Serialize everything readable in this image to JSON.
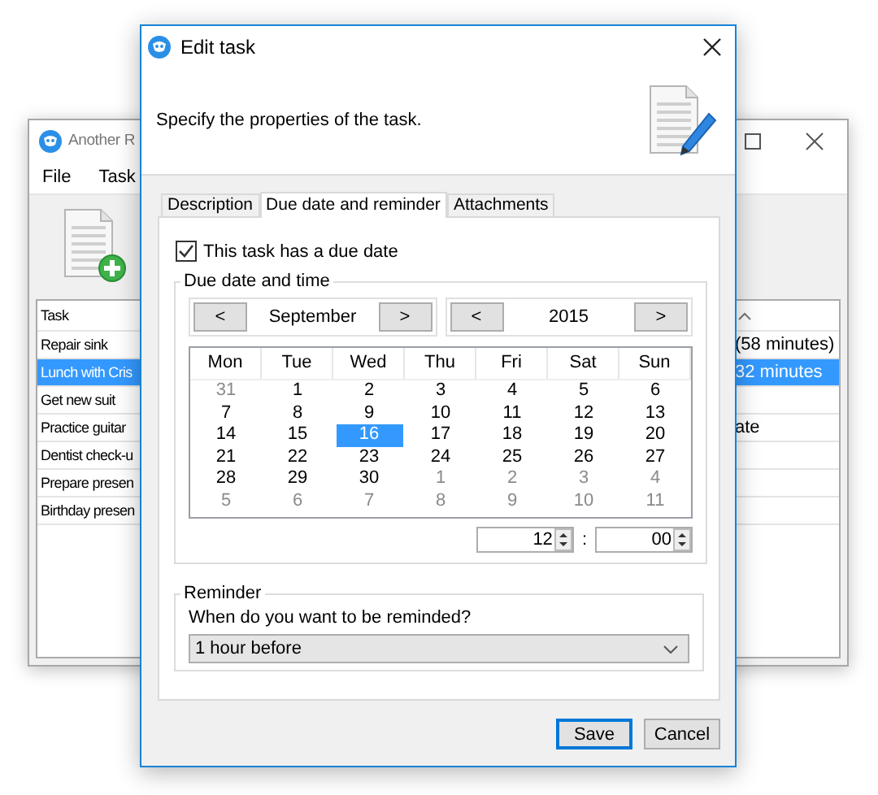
{
  "background_window": {
    "title": "Another R",
    "menu": [
      "File",
      "Task"
    ],
    "table": {
      "columns": [
        "Task"
      ],
      "rows": [
        {
          "task": "Repair sink",
          "column_2": "(58 minutes)",
          "selected": false
        },
        {
          "task": "Lunch with Cris",
          "column_2": "32 minutes",
          "selected": true
        },
        {
          "task": "Get new suit",
          "selected": false
        },
        {
          "task": "Practice guitar",
          "column_2": "ate",
          "selected": false
        },
        {
          "task": "Dentist check-u",
          "selected": false
        },
        {
          "task": "Prepare presen",
          "selected": false
        },
        {
          "task": "Birthday presen",
          "selected": false
        }
      ]
    }
  },
  "dialog": {
    "title": "Edit task",
    "instruction": "Specify the properties of the task.",
    "tabs": [
      {
        "label": "Description",
        "selected": false
      },
      {
        "label": "Due date and reminder",
        "selected": true
      },
      {
        "label": "Attachments",
        "selected": false
      }
    ],
    "has_due_date": {
      "label": "This task has a due date",
      "checked": true
    },
    "due_date_group": {
      "title": "Due date and time",
      "month": {
        "prev": "<",
        "value": "September",
        "next": ">"
      },
      "year": {
        "prev": "<",
        "value": "2015",
        "next": ">"
      },
      "weekdays": [
        "Mon",
        "Tue",
        "Wed",
        "Thu",
        "Fri",
        "Sat",
        "Sun"
      ],
      "weeks": [
        [
          {
            "day": "31",
            "in_month": false,
            "selected": false
          },
          {
            "day": "1",
            "in_month": true,
            "selected": false
          },
          {
            "day": "2",
            "in_month": true,
            "selected": false
          },
          {
            "day": "3",
            "in_month": true,
            "selected": false
          },
          {
            "day": "4",
            "in_month": true,
            "selected": false
          },
          {
            "day": "5",
            "in_month": true,
            "selected": false
          },
          {
            "day": "6",
            "in_month": true,
            "selected": false
          }
        ],
        [
          {
            "day": "7",
            "in_month": true,
            "selected": false
          },
          {
            "day": "8",
            "in_month": true,
            "selected": false
          },
          {
            "day": "9",
            "in_month": true,
            "selected": false
          },
          {
            "day": "10",
            "in_month": true,
            "selected": false
          },
          {
            "day": "11",
            "in_month": true,
            "selected": false
          },
          {
            "day": "12",
            "in_month": true,
            "selected": false
          },
          {
            "day": "13",
            "in_month": true,
            "selected": false
          }
        ],
        [
          {
            "day": "14",
            "in_month": true,
            "selected": false
          },
          {
            "day": "15",
            "in_month": true,
            "selected": false
          },
          {
            "day": "16",
            "in_month": true,
            "selected": true
          },
          {
            "day": "17",
            "in_month": true,
            "selected": false
          },
          {
            "day": "18",
            "in_month": true,
            "selected": false
          },
          {
            "day": "19",
            "in_month": true,
            "selected": false
          },
          {
            "day": "20",
            "in_month": true,
            "selected": false
          }
        ],
        [
          {
            "day": "21",
            "in_month": true,
            "selected": false
          },
          {
            "day": "22",
            "in_month": true,
            "selected": false
          },
          {
            "day": "23",
            "in_month": true,
            "selected": false
          },
          {
            "day": "24",
            "in_month": true,
            "selected": false
          },
          {
            "day": "25",
            "in_month": true,
            "selected": false
          },
          {
            "day": "26",
            "in_month": true,
            "selected": false
          },
          {
            "day": "27",
            "in_month": true,
            "selected": false
          }
        ],
        [
          {
            "day": "28",
            "in_month": true,
            "selected": false
          },
          {
            "day": "29",
            "in_month": true,
            "selected": false
          },
          {
            "day": "30",
            "in_month": true,
            "selected": false
          },
          {
            "day": "1",
            "in_month": false,
            "selected": false
          },
          {
            "day": "2",
            "in_month": false,
            "selected": false
          },
          {
            "day": "3",
            "in_month": false,
            "selected": false
          },
          {
            "day": "4",
            "in_month": false,
            "selected": false
          }
        ],
        [
          {
            "day": "5",
            "in_month": false,
            "selected": false
          },
          {
            "day": "6",
            "in_month": false,
            "selected": false
          },
          {
            "day": "7",
            "in_month": false,
            "selected": false
          },
          {
            "day": "8",
            "in_month": false,
            "selected": false
          },
          {
            "day": "9",
            "in_month": false,
            "selected": false
          },
          {
            "day": "10",
            "in_month": false,
            "selected": false
          },
          {
            "day": "11",
            "in_month": false,
            "selected": false
          }
        ]
      ],
      "hour": "12",
      "separator": ":",
      "minute": "00"
    },
    "reminder_group": {
      "title": "Reminder",
      "question": "When do you want to be reminded?",
      "value": "1 hour before"
    },
    "buttons": [
      {
        "label": "Save",
        "default": true
      },
      {
        "label": "Cancel",
        "default": false
      }
    ]
  }
}
